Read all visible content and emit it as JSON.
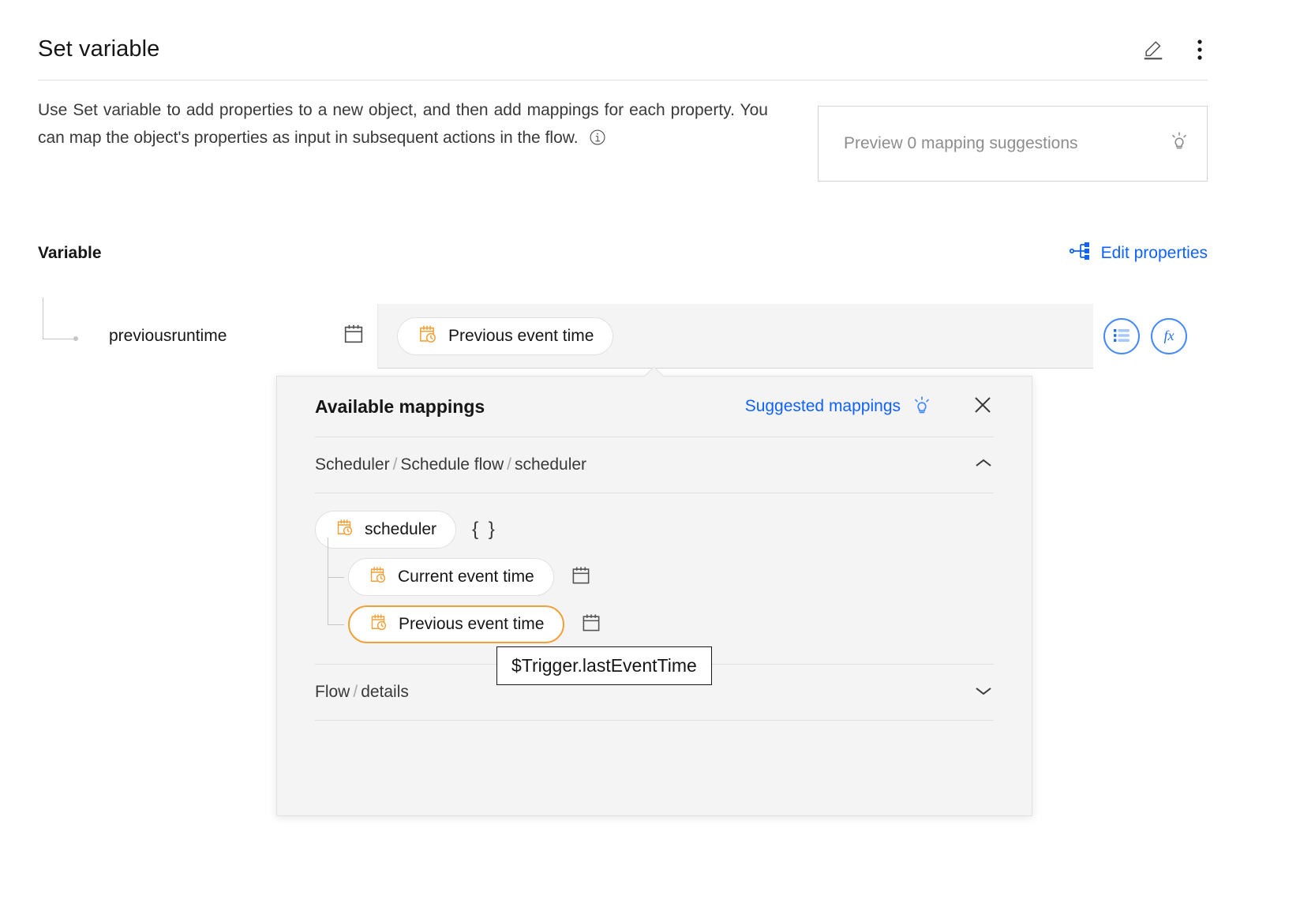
{
  "header": {
    "title": "Set variable",
    "edit_icon": "pencil-icon",
    "overflow_icon": "overflow-menu-icon"
  },
  "description": {
    "text": "Use Set variable to add properties to a new object, and then add mappings for each property. You can map the object's properties as input in subsequent actions in the flow.",
    "info_icon": "information-icon"
  },
  "preview": {
    "label": "Preview 0 mapping suggestions",
    "icon": "lightbulb-icon"
  },
  "variable_section": {
    "heading": "Variable",
    "edit_properties_label": "Edit properties",
    "edit_properties_icon": "properties-tree-icon"
  },
  "property": {
    "name": "previousruntime",
    "type_icon": "calendar-icon",
    "value_chip": {
      "label": "Previous event time",
      "icon": "event-time-icon"
    },
    "actions": [
      {
        "name": "list-view-button",
        "icon": "list-icon"
      },
      {
        "name": "expression-button",
        "icon": "fx-icon"
      }
    ]
  },
  "mappings_panel": {
    "title": "Available mappings",
    "suggested_label": "Suggested mappings",
    "suggested_icon": "lightbulb-icon",
    "close_icon": "close-icon",
    "breadcrumb": {
      "parts": [
        "Scheduler",
        "Schedule flow",
        "scheduler"
      ],
      "separator": "/",
      "chevron": "chevron-up-icon"
    },
    "tree": [
      {
        "label": "scheduler",
        "icon": "event-time-icon",
        "suffix": "{ }",
        "level": 0,
        "selected": false
      },
      {
        "label": "Current event time",
        "icon": "event-time-icon",
        "type_icon": "calendar-icon",
        "level": 1,
        "selected": false
      },
      {
        "label": "Previous event time",
        "icon": "event-time-icon",
        "type_icon": "calendar-icon",
        "level": 1,
        "selected": true
      }
    ],
    "flow_details": {
      "parts": [
        "Flow",
        "details"
      ],
      "separator": "/",
      "chevron": "chevron-down-icon"
    }
  },
  "tooltip": {
    "text": "$Trigger.lastEventTime"
  },
  "colors": {
    "accent_blue": "#0f62fe",
    "chip_orange": "#f1a13a",
    "panel_bg": "#f4f4f4",
    "border": "#e0e0e0"
  }
}
